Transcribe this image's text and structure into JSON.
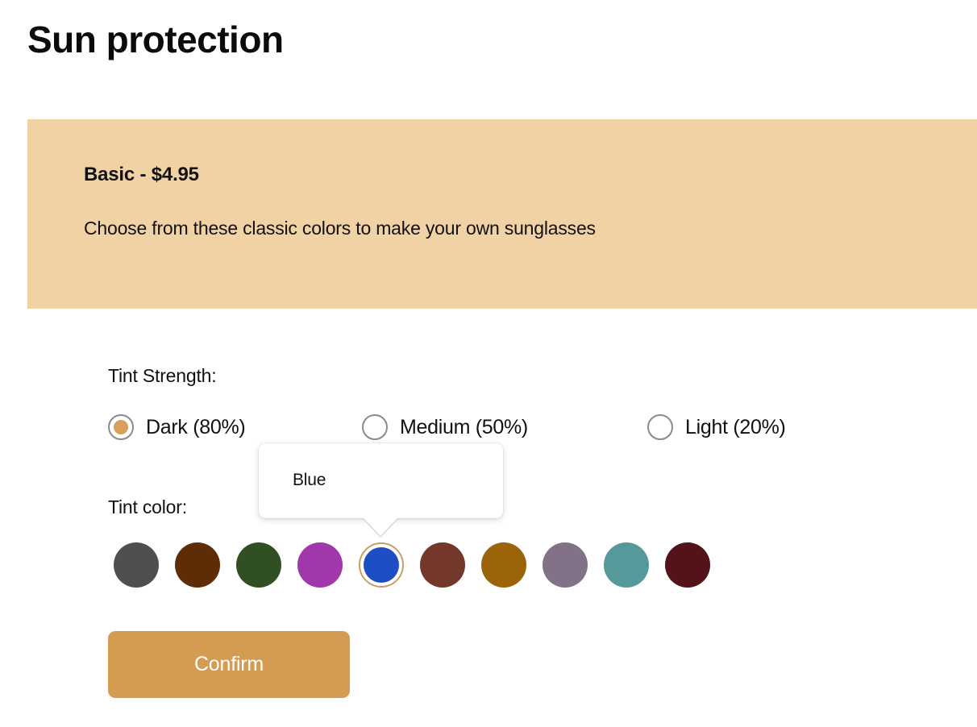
{
  "page": {
    "title": "Sun protection",
    "background_color": "#ffffff"
  },
  "banner": {
    "plan_name": "Basic - $4.95",
    "description": "Choose from these classic colors to make your own sunglasses",
    "background_color": "#f0d2a4",
    "text_color": "#111111"
  },
  "tint_strength": {
    "label": "Tint Strength:",
    "selected_index": 0,
    "selected_value": "Dark (80%)",
    "accent_color": "#d9a05b",
    "ring_color": "#8a8a8a",
    "options": [
      {
        "label": "Dark (80%)",
        "value": "80",
        "checked": true
      },
      {
        "label": "Medium (50%)",
        "value": "50",
        "checked": false
      },
      {
        "label": "Light (20%)",
        "value": "20",
        "checked": false
      }
    ]
  },
  "tint_color": {
    "label": "Tint color:",
    "selected_index": 4,
    "selected_name": "Blue",
    "selection_ring_color": "#c8a066",
    "swatches": [
      {
        "name": "Dark Gray",
        "hex": "#4d4f51",
        "selected": false
      },
      {
        "name": "Dark Brown",
        "hex": "#5f2d05",
        "selected": false
      },
      {
        "name": "Dark Green",
        "hex": "#304f23",
        "selected": false
      },
      {
        "name": "Purple",
        "hex": "#a037ad",
        "selected": false
      },
      {
        "name": "Blue",
        "hex": "#1e4ec4",
        "selected": true
      },
      {
        "name": "Sienna",
        "hex": "#74382a",
        "selected": false
      },
      {
        "name": "Dark Goldenrod",
        "hex": "#9c6408",
        "selected": false
      },
      {
        "name": "Mauve",
        "hex": "#837188",
        "selected": false
      },
      {
        "name": "Teal",
        "hex": "#56999a",
        "selected": false
      },
      {
        "name": "Dark Maroon",
        "hex": "#541219",
        "selected": false
      }
    ]
  },
  "tooltip": {
    "text": "Blue",
    "visible": true,
    "background_color": "#ffffff",
    "points_to": "Blue"
  },
  "confirm": {
    "label": "Confirm",
    "background_color": "#d49b52",
    "text_color": "#ffffff"
  }
}
